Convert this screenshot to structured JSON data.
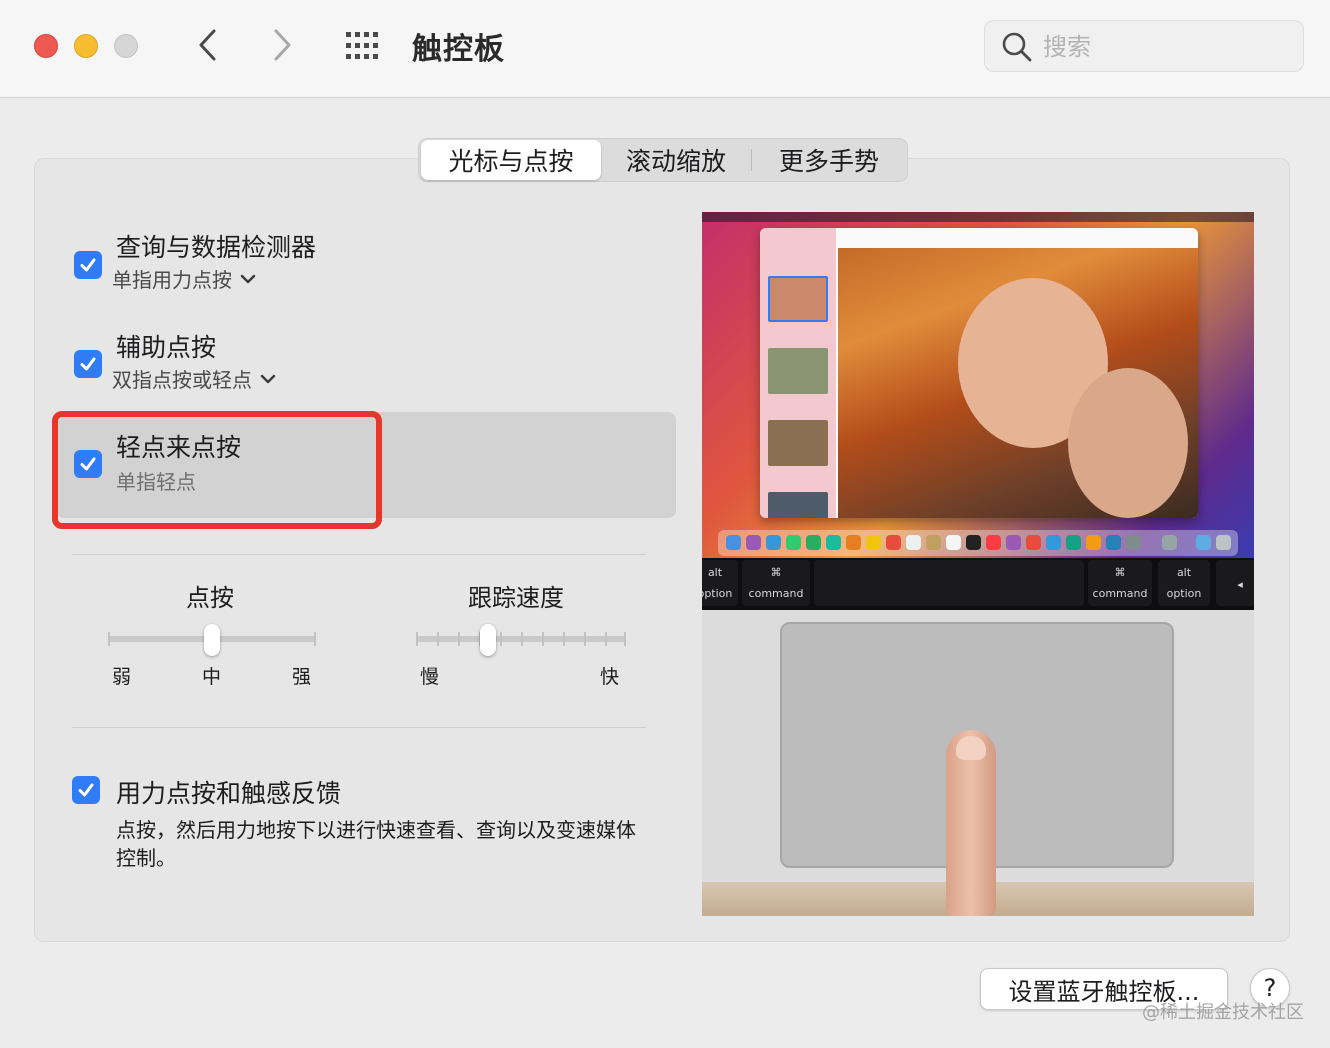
{
  "window": {
    "title": "触控板"
  },
  "search": {
    "placeholder": "搜索"
  },
  "tabs": [
    "光标与点按",
    "滚动缩放",
    "更多手势"
  ],
  "options": [
    {
      "title": "查询与数据检测器",
      "subtitle": "单指用力点按",
      "checked": true
    },
    {
      "title": "辅助点按",
      "subtitle": "双指点按或轻点",
      "checked": true
    },
    {
      "title": "轻点来点按",
      "subtitle": "单指轻点",
      "checked": true
    }
  ],
  "sliders": {
    "click": {
      "label": "点按",
      "ticks": [
        "弱",
        "中",
        "强"
      ],
      "value": 0.5
    },
    "tracking": {
      "label": "跟踪速度",
      "min_label": "慢",
      "max_label": "快",
      "value": 0.35
    }
  },
  "force_click": {
    "title": "用力点按和触感反馈",
    "description": "点按，然后用力地按下以进行快速查看、查询以及变速媒体控制。",
    "checked": true
  },
  "preview": {
    "keys": {
      "alt_left": "alt",
      "option_left": "option",
      "cmd_symbol": "⌘",
      "command_left": "command",
      "command_right": "command",
      "alt_right": "alt",
      "option_right": "option"
    }
  },
  "buttons": {
    "bluetooth": "设置蓝牙触控板...",
    "help": "?"
  },
  "watermark": "@稀土掘金技术社区",
  "colors": {
    "accent": "#2f7cf6",
    "highlight": "#e7372c"
  }
}
